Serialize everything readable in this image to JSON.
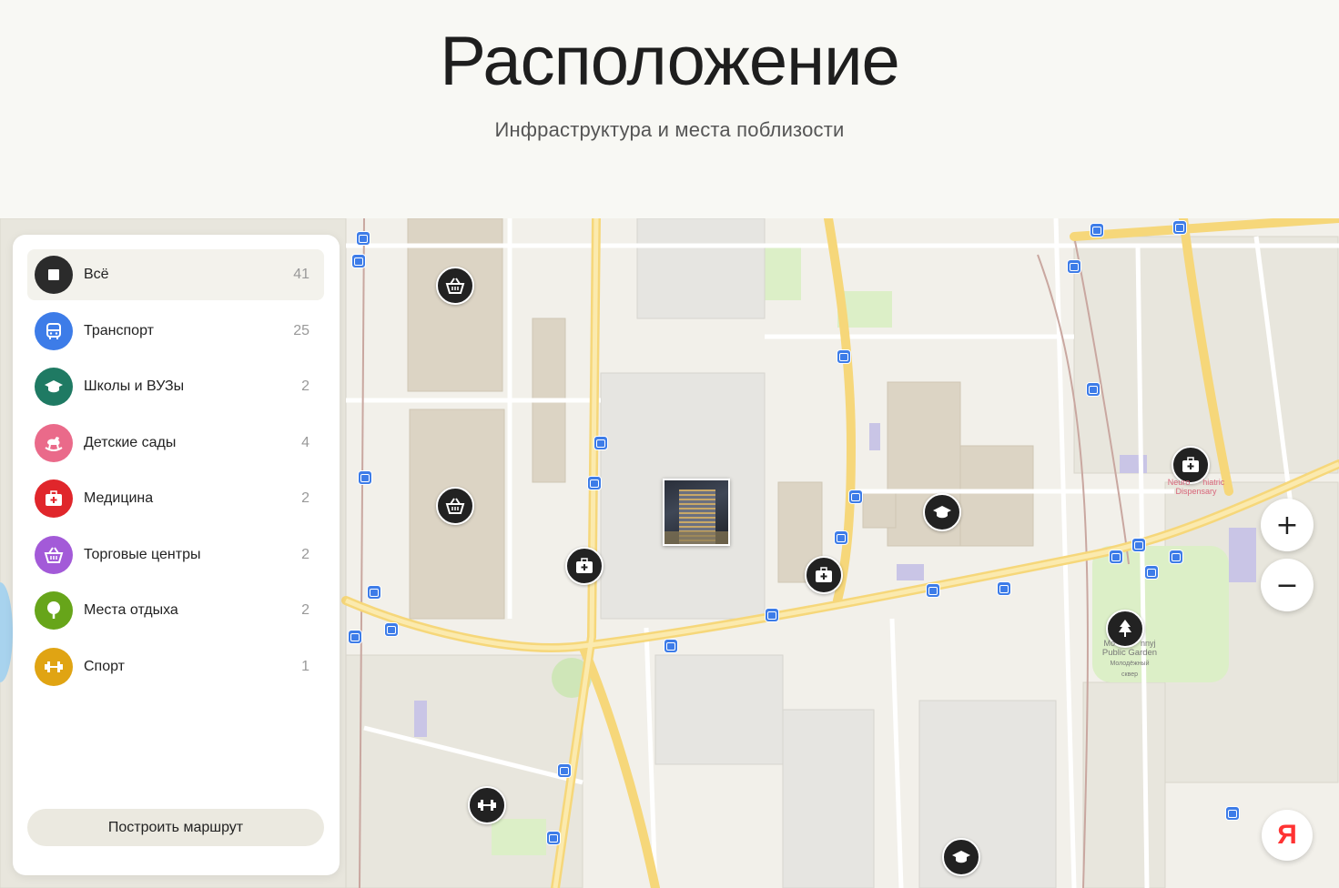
{
  "header": {
    "title": "Расположение",
    "subtitle": "Инфраструктура и места поблизости"
  },
  "colors": {
    "all": "#2b2b2b",
    "transport": "#3d7ce8",
    "schools": "#1f7a63",
    "kindergartens": "#ea6a8a",
    "medicine": "#e0262b",
    "malls": "#a35ad8",
    "recreation": "#67a51a",
    "sport": "#e0a413",
    "marker": "#222222"
  },
  "categories": [
    {
      "key": "all",
      "label": "Всё",
      "count": "41",
      "icon": "square-icon"
    },
    {
      "key": "transport",
      "label": "Транспорт",
      "count": "25",
      "icon": "bus-icon"
    },
    {
      "key": "schools",
      "label": "Школы и ВУЗы",
      "count": "2",
      "icon": "graduation-cap-icon"
    },
    {
      "key": "kindergartens",
      "label": "Детские сады",
      "count": "4",
      "icon": "rocking-horse-icon"
    },
    {
      "key": "medicine",
      "label": "Медицина",
      "count": "2",
      "icon": "medical-kit-icon"
    },
    {
      "key": "malls",
      "label": "Торговые центры",
      "count": "2",
      "icon": "basket-icon"
    },
    {
      "key": "recreation",
      "label": "Места отдыха",
      "count": "2",
      "icon": "tree-icon"
    },
    {
      "key": "sport",
      "label": "Спорт",
      "count": "1",
      "icon": "dumbbell-icon"
    }
  ],
  "route_button": "Построить маршрут",
  "map": {
    "labels": {
      "dispensary_1": "Neuro",
      "dispensary_2": "hiatric",
      "dispensary_3": "Dispensary",
      "garden_1": "Mo",
      "garden_2": "nnyj",
      "garden_3": "Public Garden",
      "garden_4": "Молодёжный",
      "garden_5": "сквер"
    },
    "zoom_in": "+",
    "zoom_out": "−",
    "provider_logo": "Я"
  }
}
